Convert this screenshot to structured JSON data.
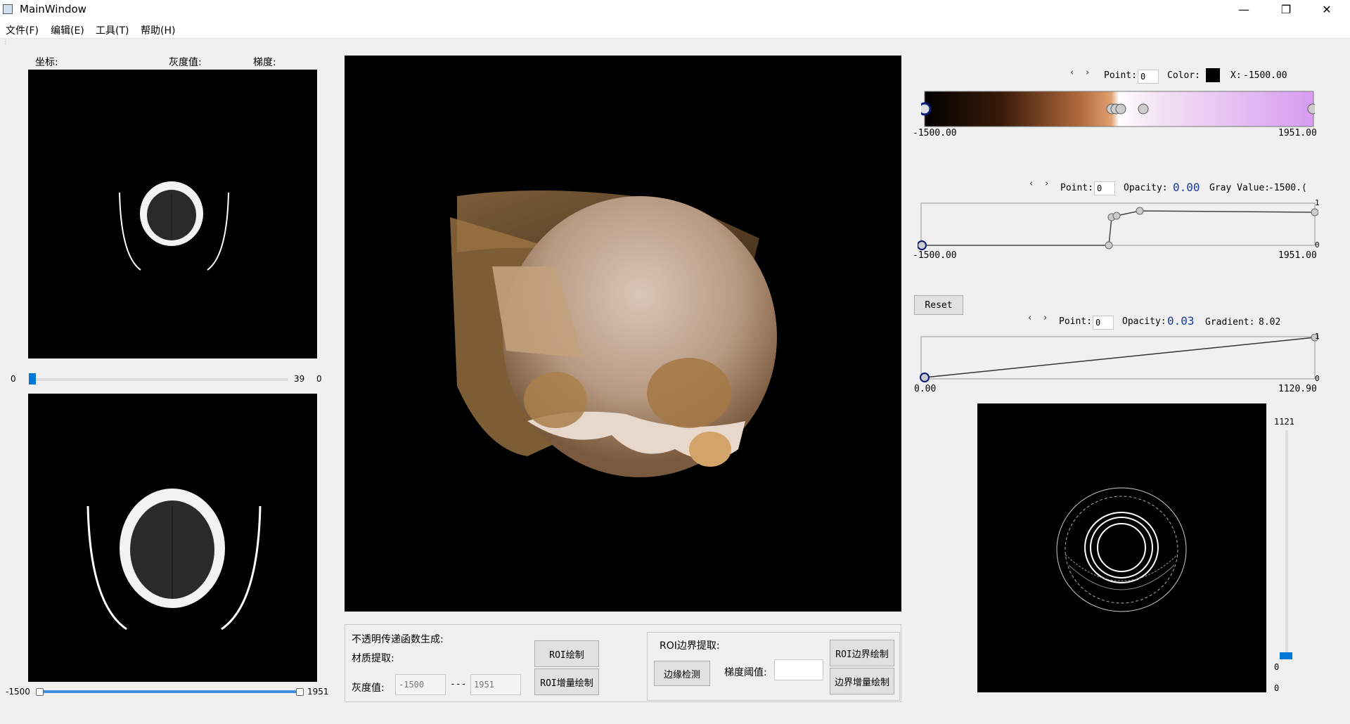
{
  "window": {
    "title": "MainWindow",
    "min": "—",
    "max": "❐",
    "close": "✕"
  },
  "menu": [
    "文件(F)",
    "编辑(E)",
    "工具(T)",
    "帮助(H)"
  ],
  "info": {
    "coord": "坐标:",
    "gray": "灰度值:",
    "gradient": "梯度:"
  },
  "slice_slider": {
    "min": "0",
    "max": "39",
    "value": "0"
  },
  "range_slider": {
    "min": "-1500",
    "max": "1951"
  },
  "color_tf": {
    "point_label": "Point:",
    "point_value": "0",
    "color_label": "Color:",
    "x_label": "X:",
    "x_value": "-1500.00",
    "range_min": "-1500.00",
    "range_max": "1951.00",
    "swatch_color": "#000000"
  },
  "opacity_tf": {
    "point_label": "Point:",
    "point_value": "0",
    "opacity_label": "Opacity:",
    "opacity_value": "0.00",
    "gray_label": "Gray Value:",
    "gray_value": "-1500.(",
    "range_min": "-1500.00",
    "range_max": "1951.00",
    "y_max": "1",
    "y_min": "0"
  },
  "gradient_tf": {
    "reset": "Reset",
    "point_label": "Point:",
    "point_value": "0",
    "opacity_label": "Opacity:",
    "opacity_value": "0.03",
    "gradient_label": "Gradient:",
    "gradient_value": "8.02",
    "range_min": "0.00",
    "range_max": "1120.90",
    "y_max": "1",
    "y_min": "0"
  },
  "edge_slider": {
    "max": "1121",
    "value": "0",
    "min": "0"
  },
  "opacity_panel": {
    "title": "不透明传递函数生成:",
    "material": "材质提取:",
    "gray_label": "灰度值:",
    "min_placeholder": "-1500",
    "sep": "---",
    "max_placeholder": "1951",
    "roi_draw": "ROI绘制",
    "roi_incremental": "ROI增量绘制"
  },
  "edge_panel": {
    "title": "ROI边界提取:",
    "detect": "边缘检测",
    "threshold_label": "梯度阈值:",
    "roi_edge_draw": "ROI边界绘制",
    "edge_incremental": "边界增量绘制"
  }
}
